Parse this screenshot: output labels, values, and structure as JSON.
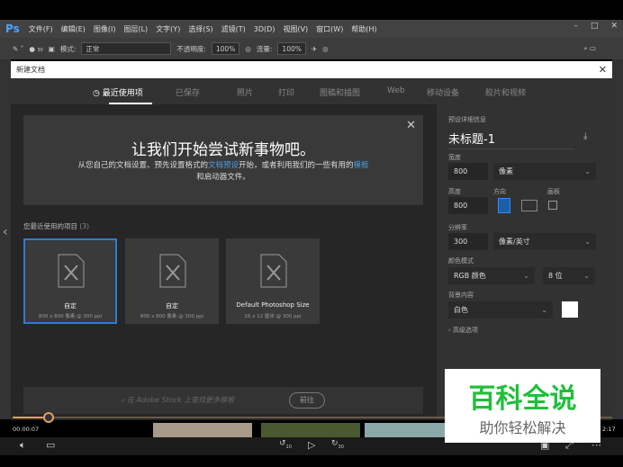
{
  "app": {
    "logo": "Ps",
    "menu": [
      "文件(F)",
      "编辑(E)",
      "图像(I)",
      "图层(L)",
      "文字(Y)",
      "选择(S)",
      "滤镜(T)",
      "3D(D)",
      "视图(V)",
      "窗口(W)",
      "帮助(H)"
    ]
  },
  "options": {
    "brush_size": "30",
    "mode_label": "模式:",
    "mode_value": "正常",
    "opacity_label": "不透明度:",
    "opacity_value": "100%",
    "flow_label": "流量:",
    "flow_value": "100%"
  },
  "dialog": {
    "title": "新建文档",
    "tabs": [
      "最近使用项",
      "已保存",
      "照片",
      "打印",
      "图稿和插图",
      "Web",
      "移动设备",
      "胶片和视频"
    ],
    "welcome": {
      "title": "让我们开始尝试新事物吧。",
      "text1": "从您自己的文档设置、预先设置格式的",
      "link1": "文档预设",
      "text2": "开始，或者利用我们的一些有用的",
      "link2": "模板",
      "text3": "和启动器文件。"
    },
    "recent_label": "您最近使用的项目",
    "recent_count": "(3)",
    "cards": [
      {
        "name": "自定",
        "size": "800 x 800 像素 @ 300 ppi"
      },
      {
        "name": "自定",
        "size": "800 x 800 像素 @ 300 ppi"
      },
      {
        "name": "Default Photoshop Size",
        "size": "16 x 12 厘米 @ 300 ppi"
      }
    ],
    "stock_placeholder": "在 Adobe Stock 上查找更多模板",
    "stock_button": "前往",
    "preset": {
      "header": "预设详细信息",
      "name": "未标题-1",
      "width_label": "宽度",
      "width": "800",
      "width_unit": "像素",
      "height_label": "高度",
      "height": "800",
      "orientation_label": "方向",
      "artboard_label": "画板",
      "resolution_label": "分辨率",
      "resolution": "300",
      "resolution_unit": "像素/英寸",
      "color_mode_label": "颜色模式",
      "color_mode": "RGB 颜色",
      "bit_depth": "8 位",
      "background_label": "背景内容",
      "background": "白色",
      "advanced": "高级选项"
    }
  },
  "player": {
    "current_time": "00:00:07",
    "end_time": "2:17",
    "progress": 0.06,
    "rewind": "10",
    "forward": "30"
  },
  "watermark": {
    "title": "百科全说",
    "subtitle": "助你轻松解决"
  }
}
